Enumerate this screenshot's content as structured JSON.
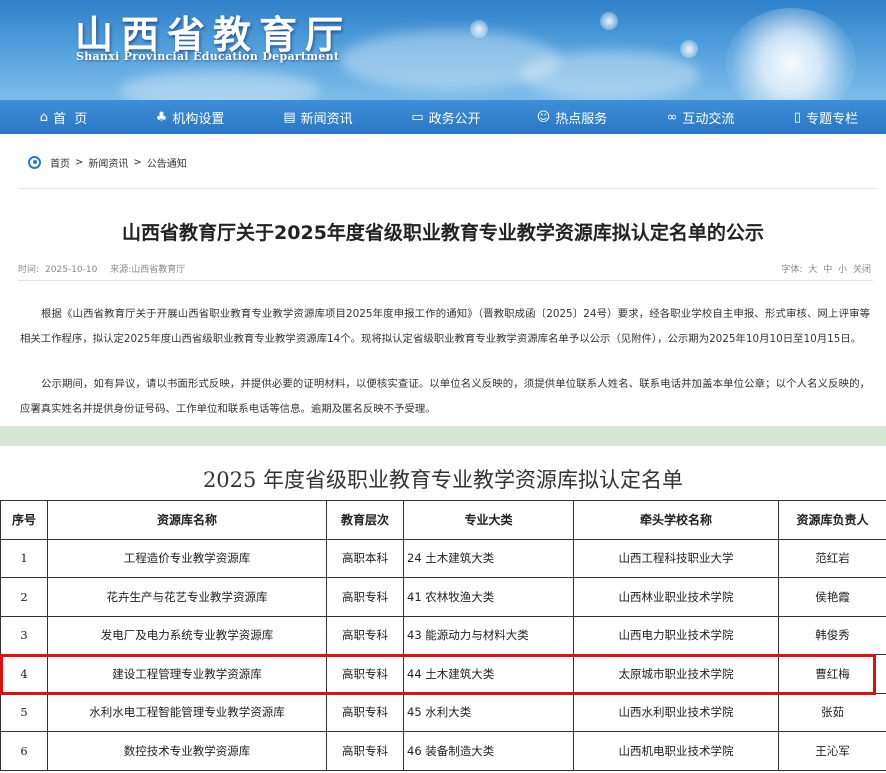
{
  "header": {
    "title": "山西省教育厅",
    "subtitle": "Shanxi Provincial Education Department"
  },
  "nav": [
    {
      "icon": "home-icon",
      "glyph": "⌂",
      "label": "首  页"
    },
    {
      "icon": "org-chart-icon",
      "glyph": "♣",
      "label": "机构设置"
    },
    {
      "icon": "document-icon",
      "glyph": "▤",
      "label": "新闻资讯"
    },
    {
      "icon": "monitor-icon",
      "glyph": "▭",
      "label": "政务公开"
    },
    {
      "icon": "user-icon",
      "glyph": "☺",
      "label": "热点服务"
    },
    {
      "icon": "link-icon",
      "glyph": "∞",
      "label": "互动交流"
    },
    {
      "icon": "bookmark-icon",
      "glyph": "▯",
      "label": "专题专栏"
    }
  ],
  "breadcrumb": [
    "首页",
    "新闻资讯",
    "公告通知"
  ],
  "article": {
    "title": "山西省教育厅关于2025年度省级职业教育专业教学资源库拟认定名单的公示",
    "time_label": "时间:",
    "time": "2025-10-10",
    "source_label": "来源:",
    "source": "山西省教育厅",
    "font_label": "字体:",
    "font_options": [
      "大",
      "中",
      "小",
      "关闭"
    ],
    "para1": "根据《山西省教育厅关于开展山西省职业教育专业教学资源库项目2025年度申报工作的通知》（晋教职成函〔2025〕24号）要求，经各职业学校自主申报、形式审核、网上评审等相关工作程序，拟认定2025年度山西省级职业教育专业教学资源库14个。现将拟认定省级职业教育专业教学资源库名单予以公示（见附件），公示期为2025年10月10日至10月15日。",
    "para2": "公示期间，如有异议，请以书面形式反映，并提供必要的证明材料，以便核实查证。以单位名义反映的，须提供单位联系人姓名、联系电话并加盖本单位公章；以个人名义反映的，应署真实姓名并提供身份证号码、工作单位和联系电话等信息。逾期及匿名反映不予受理。"
  },
  "table": {
    "title": "2025 年度省级职业教育专业教学资源库拟认定名单",
    "headers": [
      "序号",
      "资源库名称",
      "教育层次",
      "专业大类",
      "牵头学校名称",
      "资源库负责人"
    ],
    "rows": [
      [
        "1",
        "工程造价专业教学资源库",
        "高职本科",
        "24 土木建筑大类",
        "山西工程科技职业大学",
        "范红岩"
      ],
      [
        "2",
        "花卉生产与花艺专业教学资源库",
        "高职专科",
        "41 农林牧渔大类",
        "山西林业职业技术学院",
        "侯艳霞"
      ],
      [
        "3",
        "发电厂及电力系统专业教学资源库",
        "高职专科",
        "43 能源动力与材料大类",
        "山西电力职业技术学院",
        "韩俊秀"
      ],
      [
        "4",
        "建设工程管理专业教学资源库",
        "高职专科",
        "44 土木建筑大类",
        "太原城市职业技术学院",
        "曹红梅"
      ],
      [
        "5",
        "水利水电工程智能管理专业教学资源库",
        "高职专科",
        "45 水利大类",
        "山西水利职业技术学院",
        "张茹"
      ],
      [
        "6",
        "数控技术专业教学资源库",
        "高职专科",
        "46 装备制造大类",
        "山西机电职业技术学院",
        "王沁军"
      ]
    ],
    "highlighted_row": 4
  },
  "colors": {
    "nav_bg": "#2a77c4",
    "banner_top": "#2f7fc9",
    "highlight_border": "#e01010",
    "green_band": "#d6e6d4"
  }
}
